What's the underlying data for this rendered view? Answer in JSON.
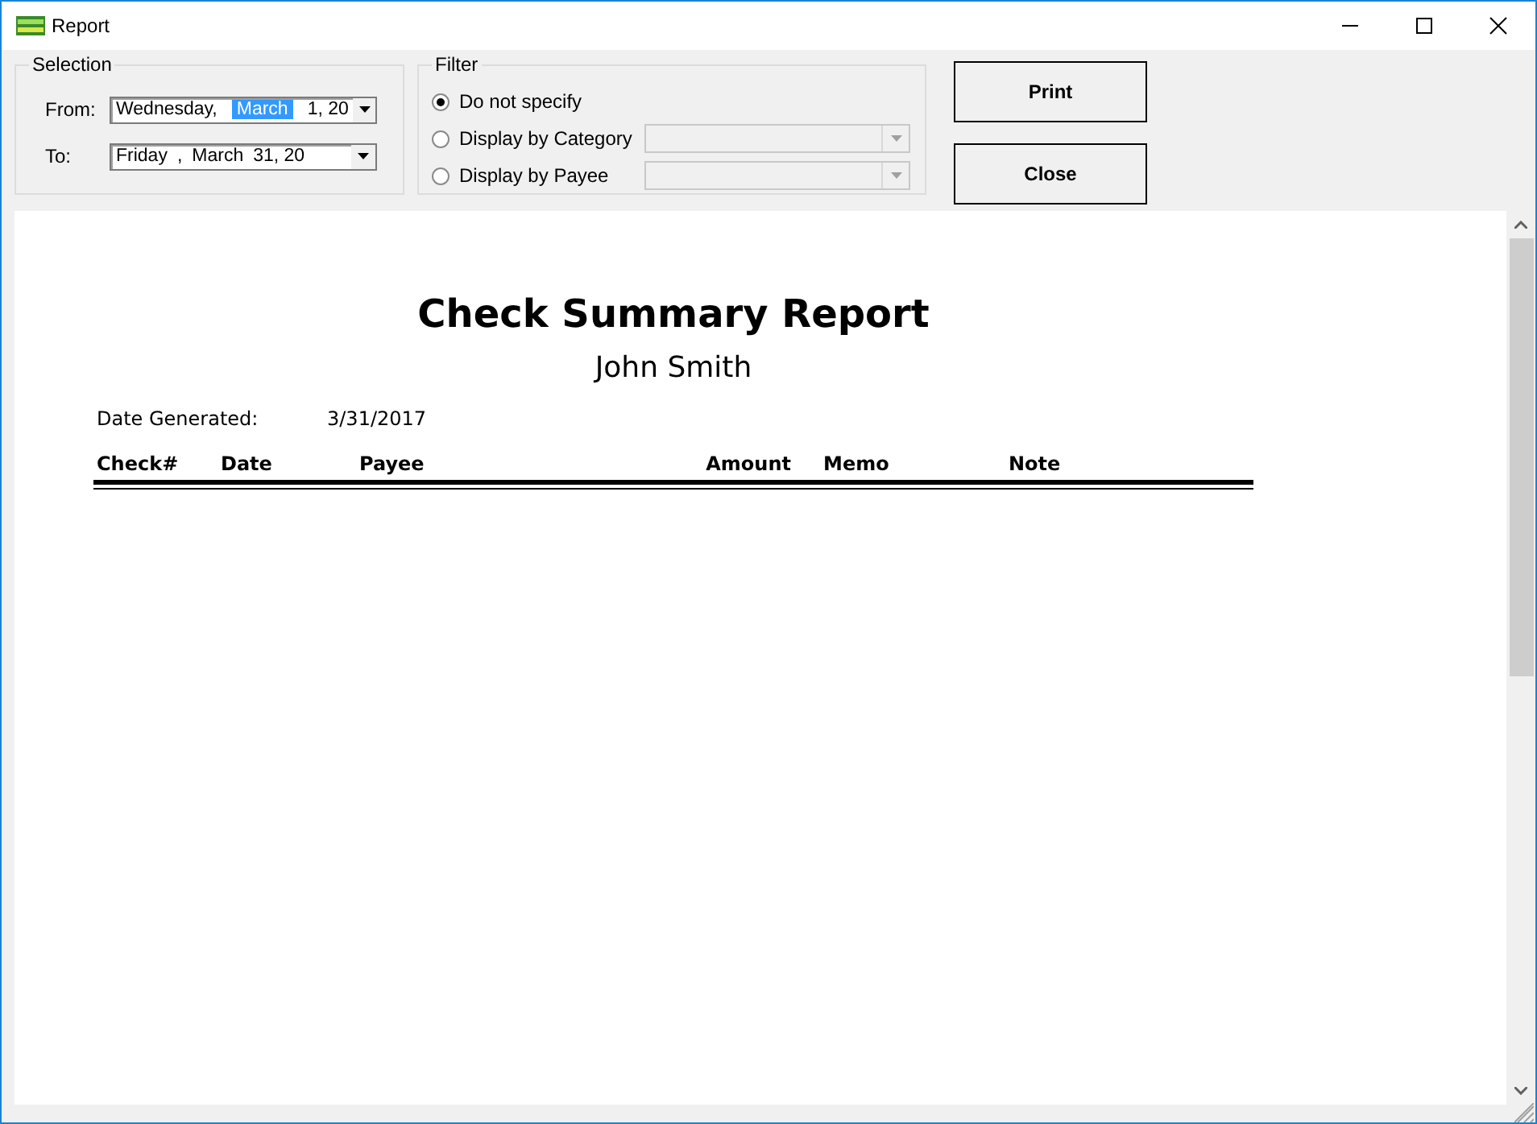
{
  "window": {
    "title": "Report"
  },
  "selection": {
    "legend": "Selection",
    "dates": [
      {
        "label": "From:",
        "segments": [
          {
            "text": "Wednesday,",
            "selected": false
          },
          {
            "text": "March",
            "selected": true
          },
          {
            "text": "1, 20",
            "selected": false
          }
        ]
      },
      {
        "label": "To:",
        "segments": [
          {
            "text": "Friday",
            "selected": false
          },
          {
            "text": ",",
            "selected": false
          },
          {
            "text": "March",
            "selected": false
          },
          {
            "text": "31, 20",
            "selected": false
          }
        ]
      }
    ]
  },
  "filter": {
    "legend": "Filter",
    "options": [
      {
        "label": "Do not specify",
        "selected": true,
        "kind": "plain"
      },
      {
        "label": "Display by Category",
        "selected": false,
        "kind": "dropdown"
      },
      {
        "label": "Display by Payee",
        "selected": false,
        "kind": "dropdown"
      }
    ]
  },
  "buttons": [
    "Print",
    "Close"
  ],
  "report": {
    "title": "Check Summary Report",
    "subtitle": "John Smith",
    "generated_label": "Date Generated:",
    "generated_value": "3/31/2017",
    "columns": [
      "Check#",
      "Date",
      "Payee",
      "Amount",
      "Memo",
      "Note"
    ]
  }
}
